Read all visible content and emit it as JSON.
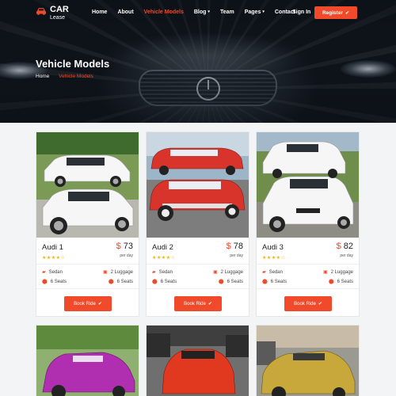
{
  "brand": {
    "name": "CAR",
    "sub": "Lease",
    "accent": "#f04a2a"
  },
  "nav": {
    "items": [
      {
        "label": "Home",
        "caret": ""
      },
      {
        "label": "About",
        "caret": ""
      },
      {
        "label": "Vehicle Models",
        "caret": ""
      },
      {
        "label": "Blog",
        "caret": "▾"
      },
      {
        "label": "Team",
        "caret": ""
      },
      {
        "label": "Pages",
        "caret": "▾"
      },
      {
        "label": "Contact",
        "caret": ""
      }
    ],
    "active": "Vehicle Models",
    "sign_in": "Sign In",
    "register": "Register"
  },
  "hero": {
    "title": "Vehicle Models",
    "breadcrumb": [
      "Home",
      "Vehicle Models"
    ]
  },
  "cards": [
    {
      "name": "Audi 1",
      "currency": "$",
      "price": "73",
      "per": "per day",
      "rating": 4,
      "trans": "Sedan",
      "luggage": "2 Luggage",
      "seats": "6 Seats",
      "seats2": "6 Seats",
      "button": "Book Ride",
      "car_color": "#f4f4f4"
    },
    {
      "name": "Audi 2",
      "currency": "$",
      "price": "78",
      "per": "per day",
      "rating": 4,
      "trans": "Sedan",
      "luggage": "2 Luggage",
      "seats": "6 Seats",
      "seats2": "6 Seats",
      "button": "Book Ride",
      "car_color": "#d9342b"
    },
    {
      "name": "Audi 3",
      "currency": "$",
      "price": "82",
      "per": "per day",
      "rating": 4,
      "trans": "Sedan",
      "luggage": "2 Luggage",
      "seats": "6 Seats",
      "seats2": "6 Seats",
      "button": "Book Ride",
      "car_color": "#f4f4f4"
    }
  ],
  "bottom_row": [
    {
      "car_color": "#b02fb0"
    },
    {
      "car_color": "#e0391f"
    },
    {
      "car_color": "#c8a83a"
    }
  ]
}
